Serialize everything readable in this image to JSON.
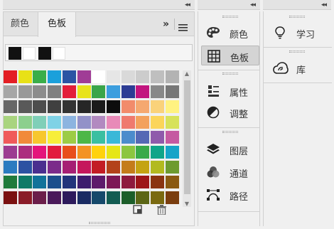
{
  "collapse_glyph": "◂◂",
  "swatches_panel": {
    "tabs": [
      {
        "label": "颜色",
        "active": false
      },
      {
        "label": "色板",
        "active": true
      }
    ],
    "flyout_arrows": "»",
    "menu_icon": "hamburger-icon",
    "recent_colors": [
      "#111111",
      "#ffffff",
      "#111111",
      "#ffffff"
    ],
    "swatch_rows": [
      [
        "#e31e24",
        "#e8e117",
        "#3aae49",
        "#1ba0db",
        "#2b54a4",
        "#a03c96",
        "#ffffff",
        "#e6e6e6",
        "#d9d9d9",
        "#cccccc",
        "#bfbfbf",
        "#b3b3b3"
      ],
      [
        "#a6a6a6",
        "#999999",
        "#8c8c8c",
        "#808080",
        "#e31e3a",
        "#e8e31c",
        "#3aa54a",
        "#3c9ede",
        "#2c3c94",
        "#c2157f",
        "#888888",
        "#777777"
      ],
      [
        "#666666",
        "#595959",
        "#4d4d4d",
        "#404040",
        "#333333",
        "#262626",
        "#1a1a1a",
        "#0d0d0d",
        "#f28b6b",
        "#f5a870",
        "#fad27a",
        "#fff280"
      ],
      [
        "#a9d47f",
        "#8ccf8d",
        "#7fcfb8",
        "#7fd2e6",
        "#8cb4e0",
        "#9291c8",
        "#b28ac0",
        "#e88ab8",
        "#ef7a6e",
        "#f3a15d",
        "#fbd55a",
        "#d7e25a"
      ],
      [
        "#f05a5a",
        "#f18a3a",
        "#f7c72e",
        "#f7ee3a",
        "#9ccc46",
        "#4cb748",
        "#3bbfa1",
        "#3ab8d8",
        "#4b8ccc",
        "#5569b5",
        "#8f5aab",
        "#c55aa1"
      ],
      [
        "#9c3c91",
        "#ac2d7f",
        "#e4157b",
        "#e21c3e",
        "#e84e1b",
        "#f39323",
        "#ffd20d",
        "#e6e617",
        "#8cc63f",
        "#3aaa49",
        "#0fa589",
        "#16a4c8"
      ],
      [
        "#2b7bc0",
        "#2c52a2",
        "#4a2f8f",
        "#7b2b8a",
        "#a61f74",
        "#c5175c",
        "#c31c24",
        "#b3421a",
        "#c47c1a",
        "#c4a312",
        "#b2ba1f",
        "#6d9b2f"
      ],
      [
        "#207a3b",
        "#0f7a67",
        "#11739a",
        "#1b4f8c",
        "#21347b",
        "#3d1d6e",
        "#5e1a6b",
        "#7d1856",
        "#8e1a3e",
        "#9d1619",
        "#8a3410",
        "#8a5a11"
      ],
      [
        "#7a1010",
        "#8a1c28",
        "#6b1e4a",
        "#4a1a5a",
        "#2d1a5c",
        "#1a2b63",
        "#16496b",
        "#135c52",
        "#1c5e2a",
        "#5c6616",
        "#7a6910",
        "#7a3d0e"
      ]
    ],
    "footer_icons": [
      "new-swatch-icon",
      "trash-icon"
    ]
  },
  "middle_column": {
    "groups": [
      {
        "items": [
          {
            "label": "颜色",
            "icon": "palette-icon",
            "selected": false
          },
          {
            "label": "色板",
            "icon": "swatches-grid-icon",
            "selected": true
          }
        ]
      },
      {
        "items": [
          {
            "label": "属性",
            "icon": "properties-icon",
            "selected": false
          },
          {
            "label": "调整",
            "icon": "adjustments-icon",
            "selected": false
          }
        ]
      },
      {
        "items": [
          {
            "label": "图层",
            "icon": "layers-icon",
            "selected": false
          },
          {
            "label": "通道",
            "icon": "channels-icon",
            "selected": false
          },
          {
            "label": "路径",
            "icon": "paths-icon",
            "selected": false
          }
        ]
      }
    ]
  },
  "right_column": {
    "items": [
      {
        "label": "学习",
        "icon": "lightbulb-icon"
      },
      {
        "label": "库",
        "icon": "libraries-icon"
      }
    ]
  }
}
